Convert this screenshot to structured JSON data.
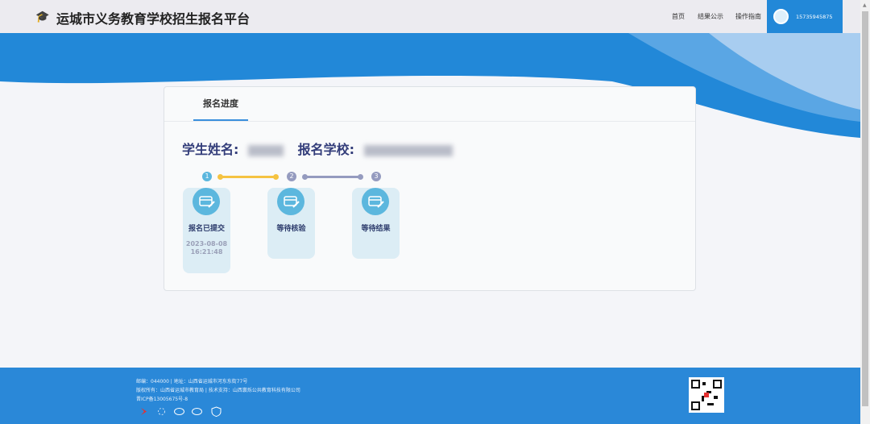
{
  "header": {
    "title": "运城市义务教育学校招生报名平台",
    "nav": [
      "首页",
      "结果公示",
      "操作指南"
    ],
    "user_phone": "15735945875"
  },
  "card": {
    "tab": "报名进度",
    "student_label": "学生姓名:",
    "school_label": "报名学校:",
    "steps": [
      {
        "num": "1",
        "label": "报名已提交",
        "date": "2023-08-08",
        "time": "16:21:48"
      },
      {
        "num": "2",
        "label": "等待核验"
      },
      {
        "num": "3",
        "label": "等待结果"
      }
    ]
  },
  "footer": {
    "line1": "邮编：044000 | 地址：山西省运城市河东东街77号",
    "line2": "版权所有：山西省运城市教育局 | 技术支持：山西寰烁公共教育科技有限公司",
    "line3": "晋ICP备13005675号-8"
  },
  "colors": {
    "primary": "#2288d8",
    "done_line": "#f5c342",
    "pending_line": "#959bbf",
    "step_icon": "#5cb7de"
  }
}
